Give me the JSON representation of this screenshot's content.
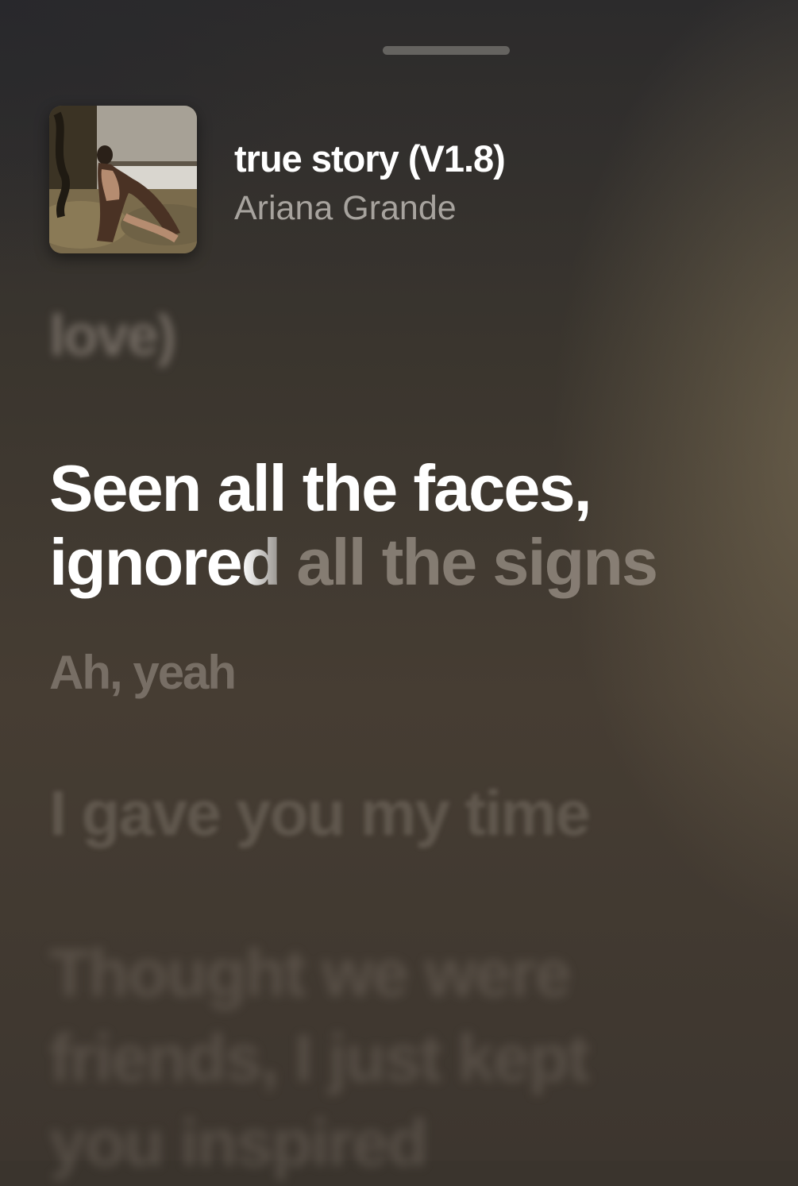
{
  "now_playing": {
    "title": "true story (V1.8)",
    "artist": "Ariana Grande"
  },
  "lyrics": {
    "previous": "love)",
    "current_line1": "Seen all the faces,",
    "current_line2_sung": "ignore",
    "current_line2_fading": "d",
    "current_line2_unsung": " all the signs",
    "next": "Ah, yeah",
    "upcoming_1": "I gave you my time",
    "upcoming_2_line1": "Thought we were",
    "upcoming_2_line2": "friends, I just kept",
    "upcoming_2_line3": "you inspired"
  },
  "colors": {
    "background": "#3a342d",
    "accent_warm": "#8c7d5f",
    "active_text": "#ffffff"
  },
  "icons": {
    "grabber": "sheet-grabber"
  }
}
